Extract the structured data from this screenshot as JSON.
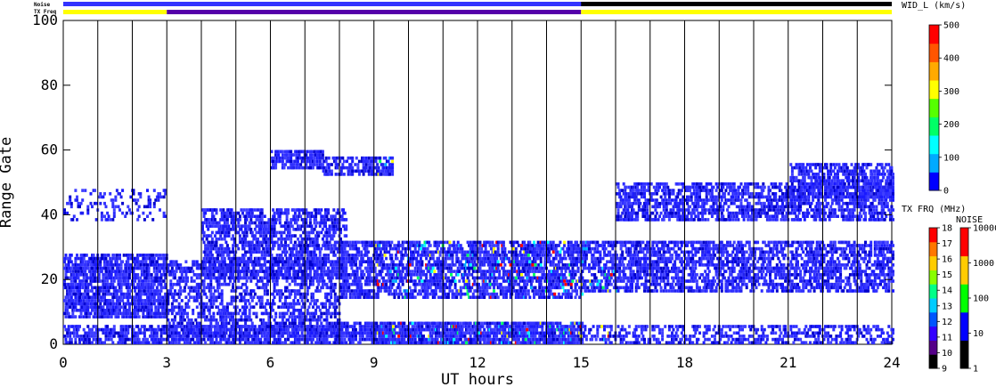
{
  "chart_data": {
    "type": "heatmap",
    "xlabel": "UT hours",
    "ylabel": "Range Gate",
    "xlim": [
      0,
      24
    ],
    "ylim": [
      0,
      100
    ],
    "x_ticks": [
      0,
      3,
      6,
      9,
      12,
      15,
      18,
      21,
      24
    ],
    "y_ticks": [
      0,
      20,
      40,
      60,
      80,
      100
    ],
    "vertical_grid_hours": [
      1,
      2,
      3,
      4,
      5,
      6,
      7,
      8,
      9,
      10,
      11,
      12,
      13,
      14,
      15,
      16,
      17,
      18,
      19,
      20,
      21,
      22,
      23
    ],
    "strips": {
      "noise_label": "Noise",
      "txfreq_label": "TX Freq",
      "noise_blue_until": 15,
      "txfreq_segments": [
        {
          "start": 0,
          "end": 3,
          "color": "#ffff00"
        },
        {
          "start": 3,
          "end": 15,
          "color": "#5500aa"
        },
        {
          "start": 15,
          "end": 24,
          "color": "#ffff00"
        }
      ]
    },
    "scatter_bands": [
      {
        "t0": 0.0,
        "t1": 3.0,
        "g0": 8,
        "g1": 28,
        "density": 0.65
      },
      {
        "t0": 0.0,
        "t1": 8.0,
        "g0": 0,
        "g1": 6,
        "density": 0.55
      },
      {
        "t0": 0.0,
        "t1": 3.0,
        "g0": 38,
        "g1": 48,
        "density": 0.15
      },
      {
        "t0": 3.0,
        "t1": 8.0,
        "g0": 2,
        "g1": 26,
        "density": 0.4
      },
      {
        "t0": 4.0,
        "t1": 8.2,
        "g0": 20,
        "g1": 42,
        "density": 0.5
      },
      {
        "t0": 6.0,
        "t1": 7.5,
        "g0": 54,
        "g1": 60,
        "density": 0.6
      },
      {
        "t0": 7.5,
        "t1": 9.5,
        "g0": 52,
        "g1": 58,
        "density": 0.5
      },
      {
        "t0": 8.0,
        "t1": 15.0,
        "g0": 0,
        "g1": 7,
        "density": 0.7
      },
      {
        "t0": 8.0,
        "t1": 15.0,
        "g0": 14,
        "g1": 32,
        "density": 0.55
      },
      {
        "t0": 15.0,
        "t1": 24.0,
        "g0": 0,
        "g1": 6,
        "density": 0.35
      },
      {
        "t0": 15.0,
        "t1": 24.0,
        "g0": 16,
        "g1": 32,
        "density": 0.5
      },
      {
        "t0": 16.0,
        "t1": 24.0,
        "g0": 38,
        "g1": 50,
        "density": 0.5
      },
      {
        "t0": 21.0,
        "t1": 24.0,
        "g0": 45,
        "g1": 56,
        "density": 0.5
      }
    ],
    "colorbars": [
      {
        "title": "WID_L (km/s)",
        "ticks": [
          "500",
          "400",
          "300",
          "200",
          "100",
          "0"
        ],
        "colors": [
          "#0000ff",
          "#00aaff",
          "#00ffff",
          "#00ff66",
          "#55ff00",
          "#ffff00",
          "#ffaa00",
          "#ff5500",
          "#ff0000"
        ]
      },
      {
        "title": "TX FRQ (MHz)",
        "ticks": [
          "18",
          "17",
          "16",
          "15",
          "14",
          "13",
          "12",
          "11",
          "10",
          "9"
        ],
        "colors": [
          "#000000",
          "#550088",
          "#3300ff",
          "#0055ff",
          "#00ccff",
          "#00ff88",
          "#88ff00",
          "#ffcc00",
          "#ff7700",
          "#ff0000"
        ]
      },
      {
        "title": "NOISE",
        "ticks": [
          "10000",
          "1000",
          "100",
          "10",
          "1"
        ],
        "colors": [
          "#000000",
          "#0000ff",
          "#00ff00",
          "#ffcc00",
          "#ff0000"
        ]
      }
    ]
  }
}
